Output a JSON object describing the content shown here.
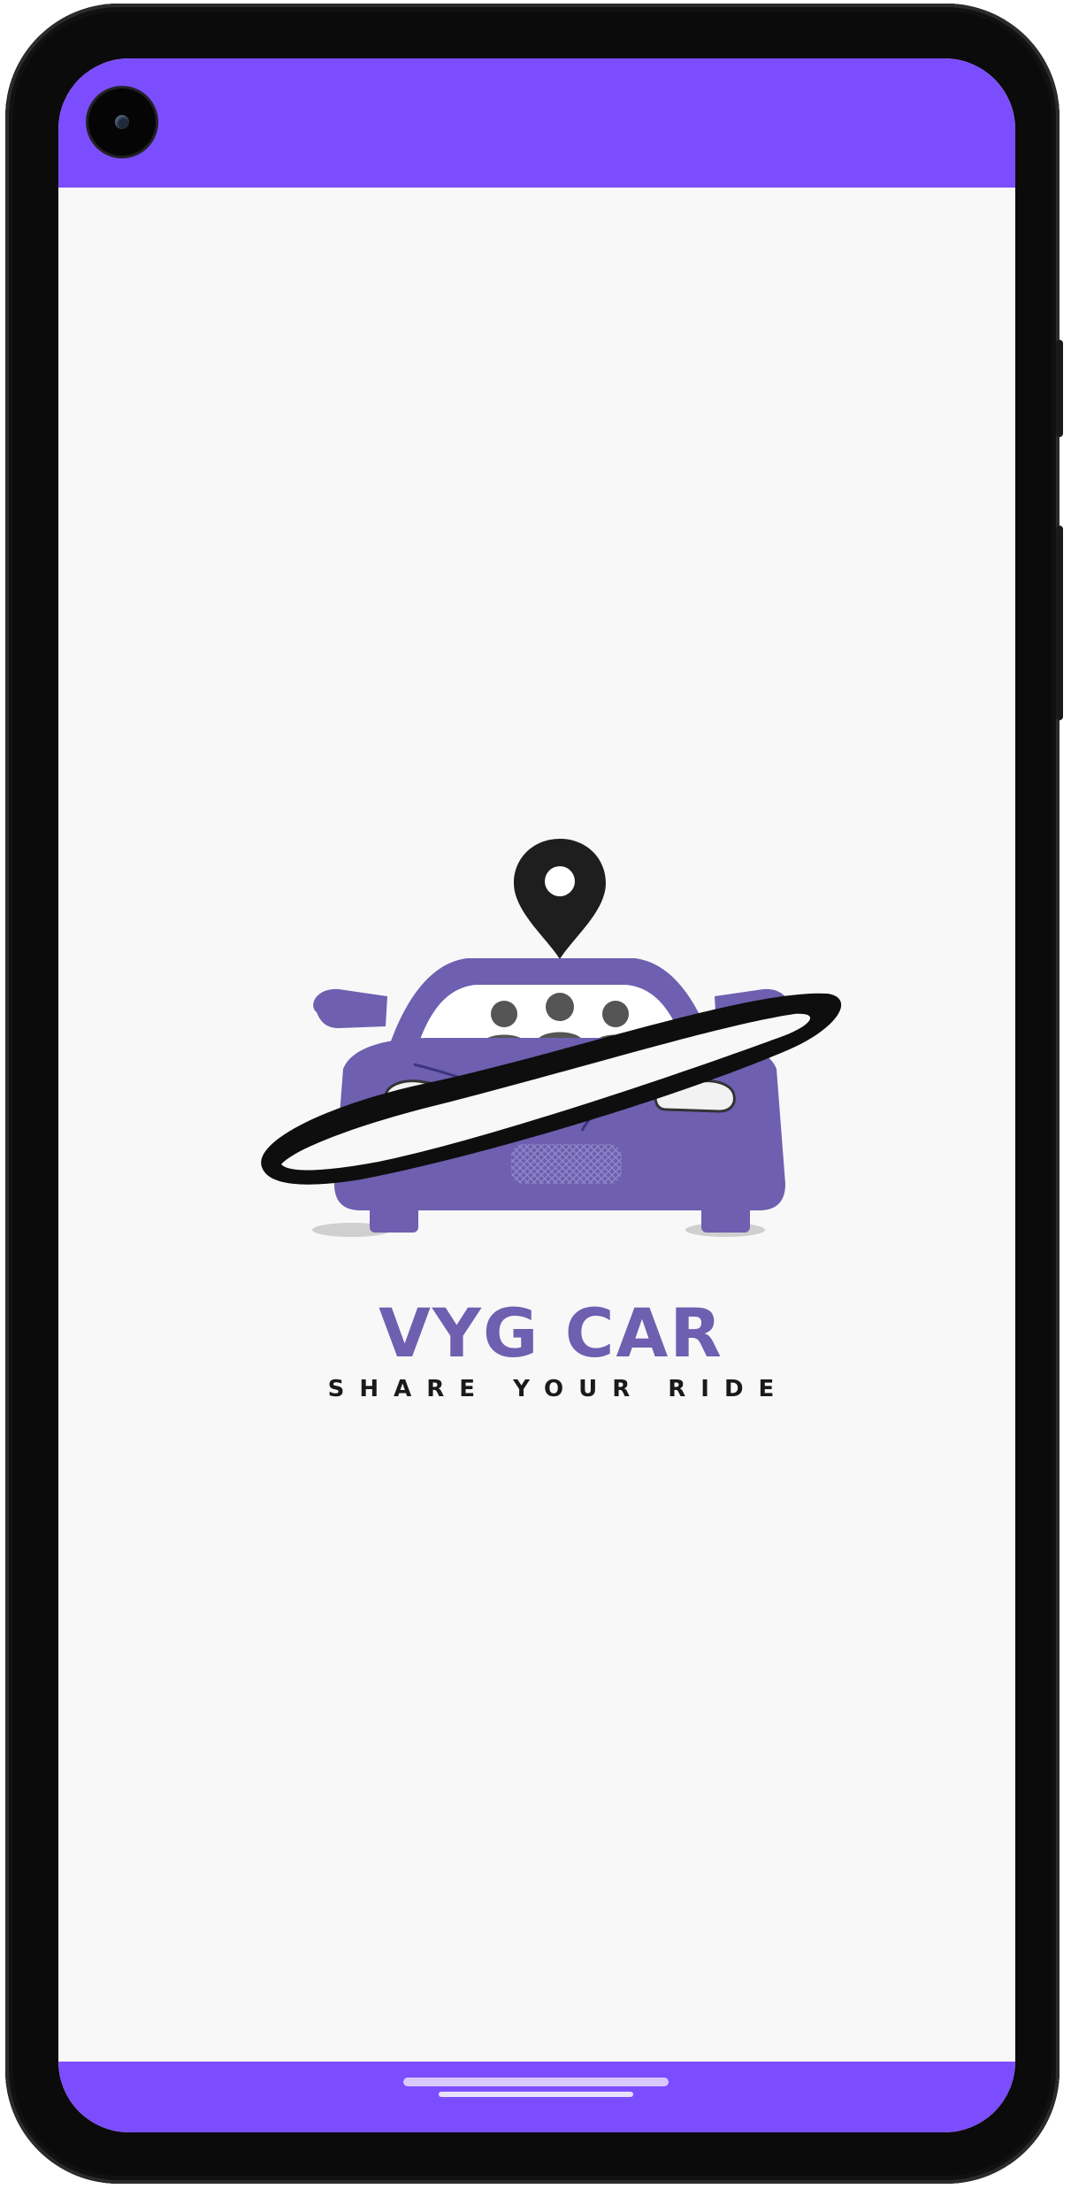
{
  "app": {
    "brand_name": "VYG CAR",
    "tagline": "SHARE YOUR RIDE"
  },
  "colors": {
    "accent": "#7c4dff",
    "brand_purple": "#6e5fb0",
    "background": "#f8f8f8",
    "dark": "#1a1a1a"
  },
  "icons": {
    "camera": "front-camera-icon",
    "pin": "location-pin-icon",
    "car": "car-icon",
    "passengers": "passengers-icon"
  }
}
